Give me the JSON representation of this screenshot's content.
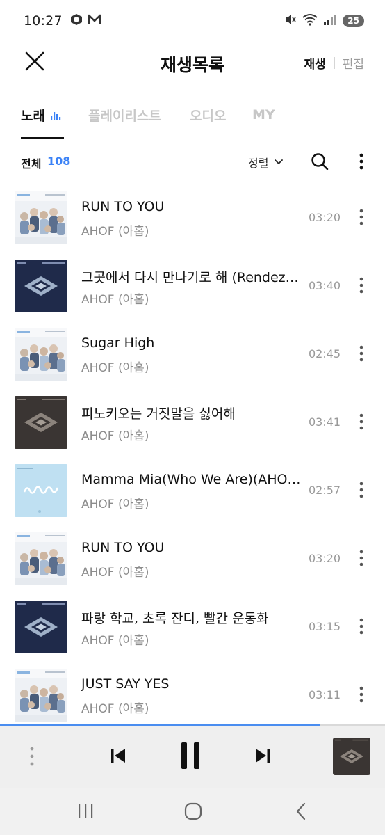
{
  "status_bar": {
    "time": "10:27",
    "left_icons": [
      "cube-icon",
      "m-logo-icon"
    ],
    "right_icons": [
      "mute-icon",
      "wifi-icon",
      "signal-icon"
    ],
    "battery": "25"
  },
  "header": {
    "title": "재생목록",
    "play_label": "재생",
    "edit_label": "편집"
  },
  "tabs": [
    {
      "label": "노래",
      "active": true
    },
    {
      "label": "플레이리스트",
      "active": false
    },
    {
      "label": "오디오",
      "active": false
    },
    {
      "label": "MY",
      "active": false
    }
  ],
  "list_header": {
    "total_label": "전체",
    "total_count": "108",
    "sort_label": "정렬"
  },
  "songs": [
    {
      "title": "RUN TO YOU",
      "artist": "AHOF (아홉)",
      "duration": "03:20",
      "art": "group-photo"
    },
    {
      "title": "그곳에서 다시 만나기로 해 (Rendezvous)",
      "artist": "AHOF (아홉)",
      "duration": "03:40",
      "art": "navy-logo"
    },
    {
      "title": "Sugar High",
      "artist": "AHOF (아홉)",
      "duration": "02:45",
      "art": "group-photo"
    },
    {
      "title": "피노키오는 거짓말을 싫어해",
      "artist": "AHOF (아홉)",
      "duration": "03:41",
      "art": "dark-logo"
    },
    {
      "title": "Mamma Mia(Who We Are)(AHOF Ver.)",
      "artist": "AHOF (아홉)",
      "duration": "02:57",
      "art": "sky-text"
    },
    {
      "title": "RUN TO YOU",
      "artist": "AHOF (아홉)",
      "duration": "03:20",
      "art": "group-photo"
    },
    {
      "title": "파랑 학교, 초록 잔디, 빨간 운동화",
      "artist": "AHOF (아홉)",
      "duration": "03:15",
      "art": "navy-logo"
    },
    {
      "title": "JUST SAY YES",
      "artist": "AHOF (아홉)",
      "duration": "03:11",
      "art": "group-photo"
    }
  ],
  "player": {
    "progress": 0.83,
    "controls": [
      "drag-handle-icon",
      "previous-icon",
      "pause-icon",
      "next-icon"
    ]
  },
  "colors": {
    "accent": "#3b82f6",
    "progress": "#4a8df0",
    "text_primary": "#111111",
    "text_secondary": "#8c8c8c",
    "tab_inactive": "#c7c7c7"
  }
}
